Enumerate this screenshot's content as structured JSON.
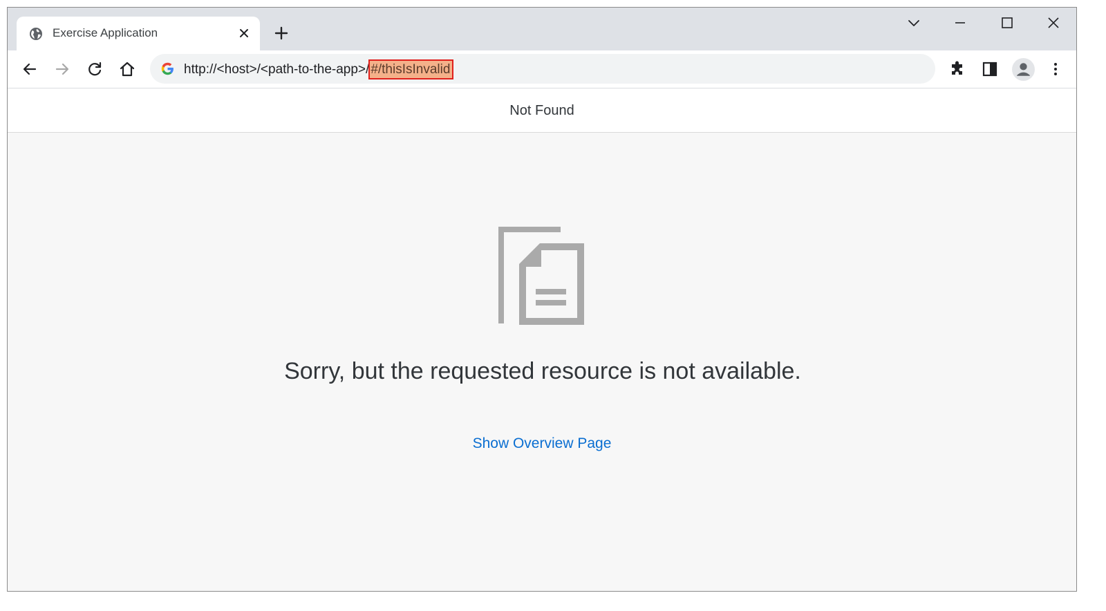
{
  "browser": {
    "tab": {
      "title": "Exercise Application",
      "icon": "globe-icon"
    },
    "address_bar": {
      "url_prefix": "http://<host>/<path-to-the-app>/",
      "url_hash": "#/thisIsInvalid",
      "highlight_color": "#f4b18a",
      "highlight_border": "#e0201c"
    },
    "toolbar_icons": [
      "back-arrow-icon",
      "forward-arrow-icon",
      "reload-icon",
      "home-icon",
      "extensions-icon",
      "side-panel-icon",
      "profile-icon",
      "kebab-menu-icon"
    ],
    "window_controls": [
      "tab-search-icon",
      "minimize-icon",
      "maximize-icon",
      "close-icon"
    ]
  },
  "page": {
    "header_title": "Not Found",
    "message": "Sorry, but the requested resource is not available.",
    "link_label": "Show Overview Page",
    "link_color": "#0a6ed1",
    "illustration": "document-icon"
  }
}
